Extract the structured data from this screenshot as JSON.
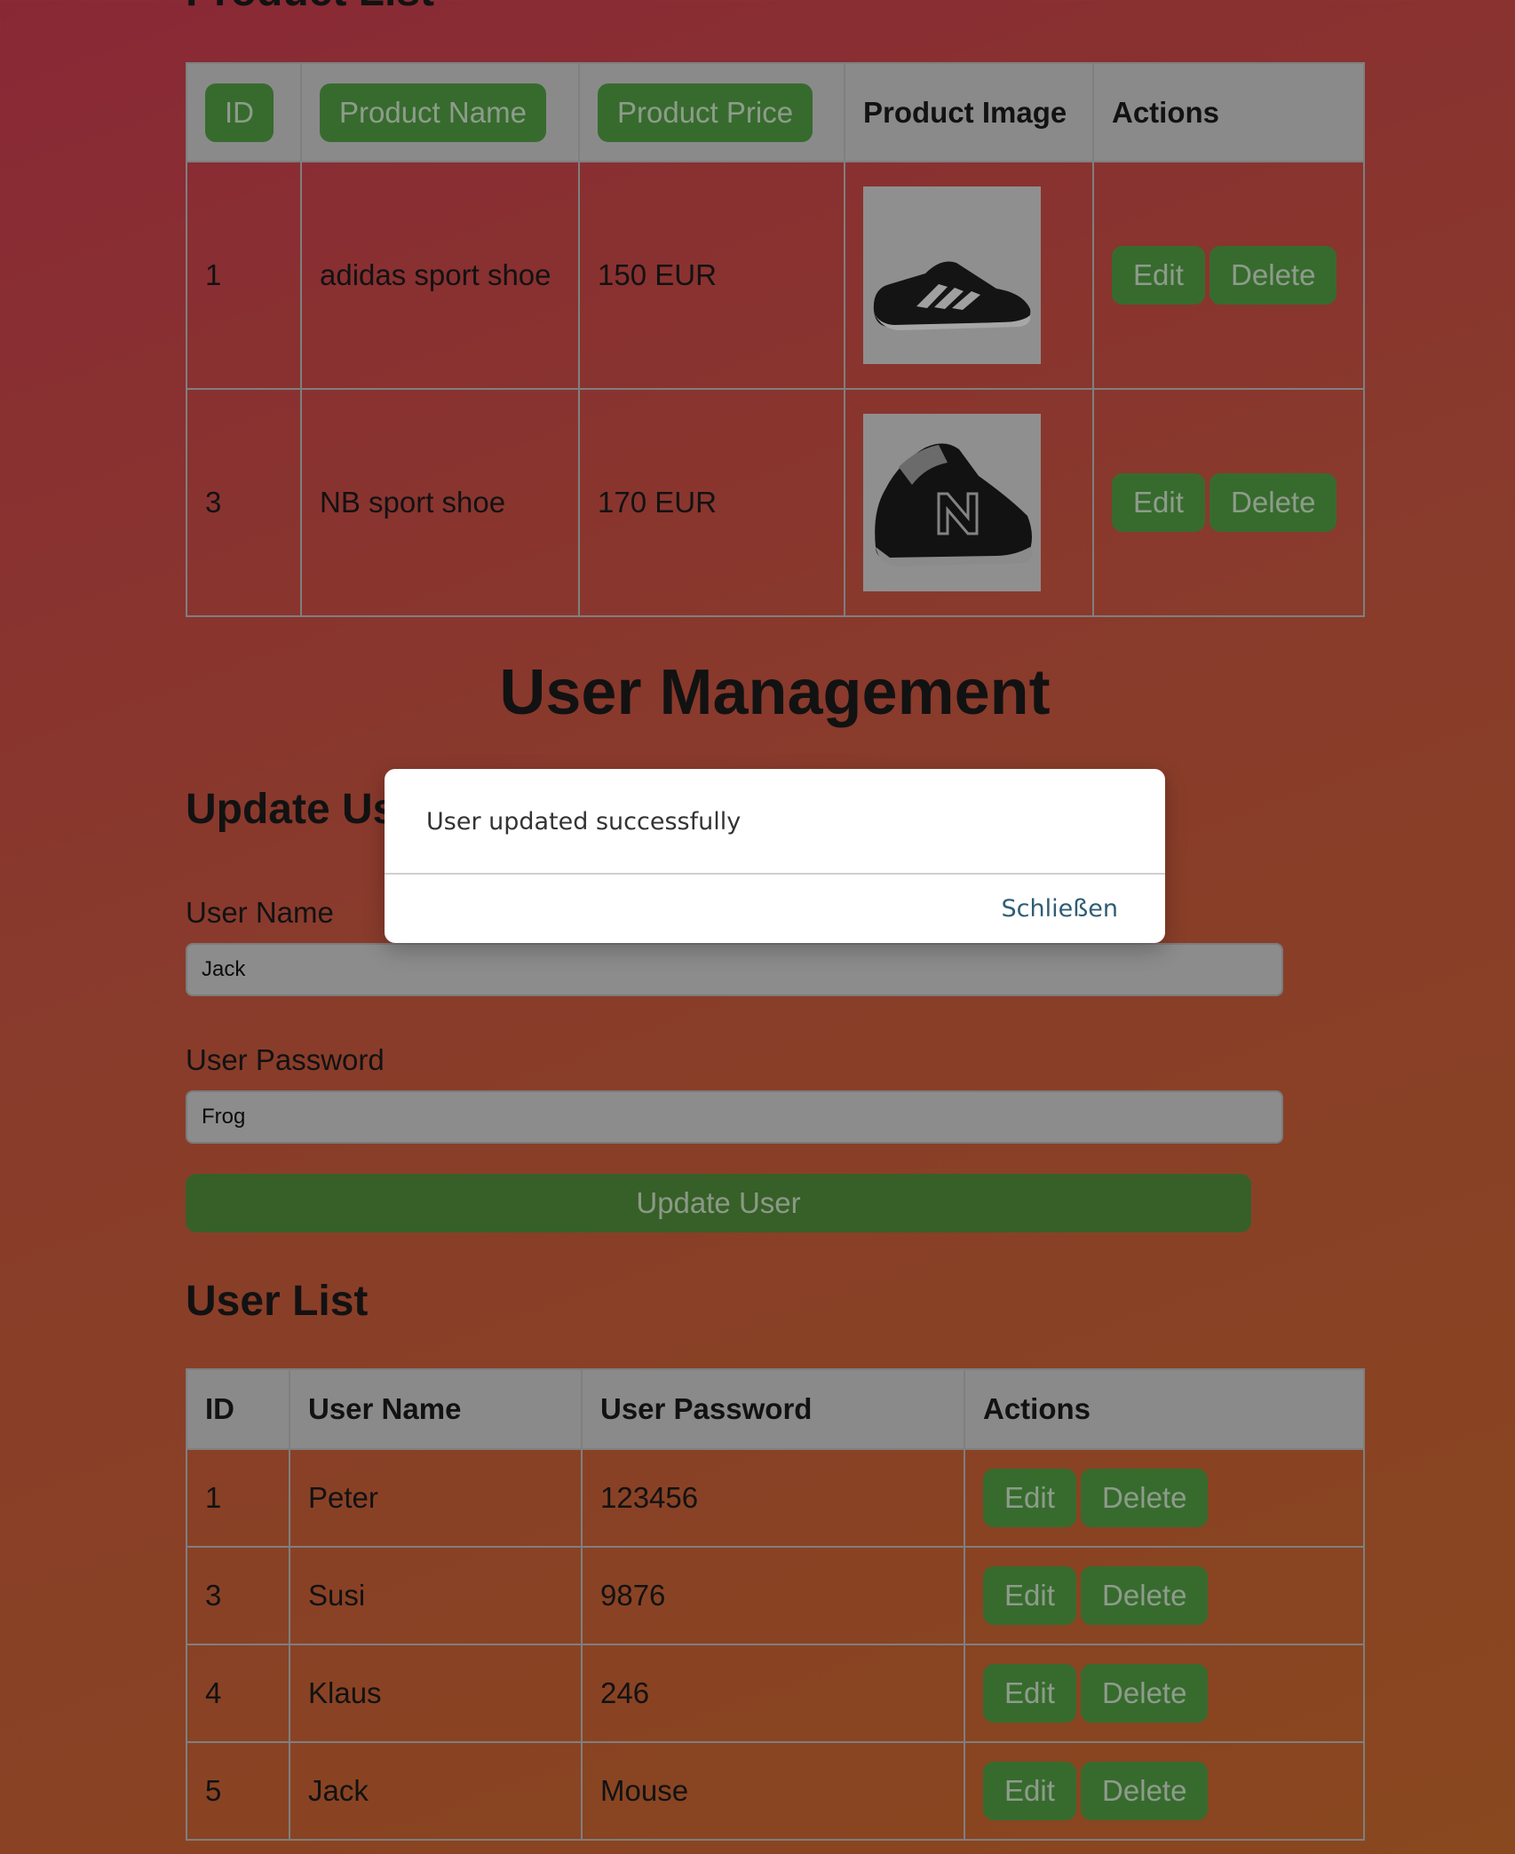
{
  "product_section": {
    "title": "Product List",
    "headers": [
      "ID",
      "Product Name",
      "Product Price",
      "Product Image",
      "Actions"
    ],
    "rows": [
      {
        "id": "1",
        "name": "adidas sport shoe",
        "price": "150 EUR",
        "image": "adidas-shoe-image"
      },
      {
        "id": "3",
        "name": "NB sport shoe",
        "price": "170 EUR",
        "image": "nb-shoe-image"
      }
    ],
    "edit_label": "Edit",
    "delete_label": "Delete"
  },
  "user_management": {
    "title": "User Management",
    "update_title": "Update User",
    "username_label": "User Name",
    "username_value": "Jack",
    "password_label": "User Password",
    "password_value": "Frog",
    "update_button": "Update User"
  },
  "user_list": {
    "title": "User List",
    "headers": [
      "ID",
      "User Name",
      "User Password",
      "Actions"
    ],
    "rows": [
      {
        "id": "1",
        "name": "Peter",
        "password": "123456"
      },
      {
        "id": "3",
        "name": "Susi",
        "password": "9876"
      },
      {
        "id": "4",
        "name": "Klaus",
        "password": "246"
      },
      {
        "id": "5",
        "name": "Jack",
        "password": "Mouse"
      }
    ],
    "edit_label": "Edit",
    "delete_label": "Delete"
  },
  "dialog": {
    "message": "User updated successfully",
    "close_label": "Schließen"
  }
}
